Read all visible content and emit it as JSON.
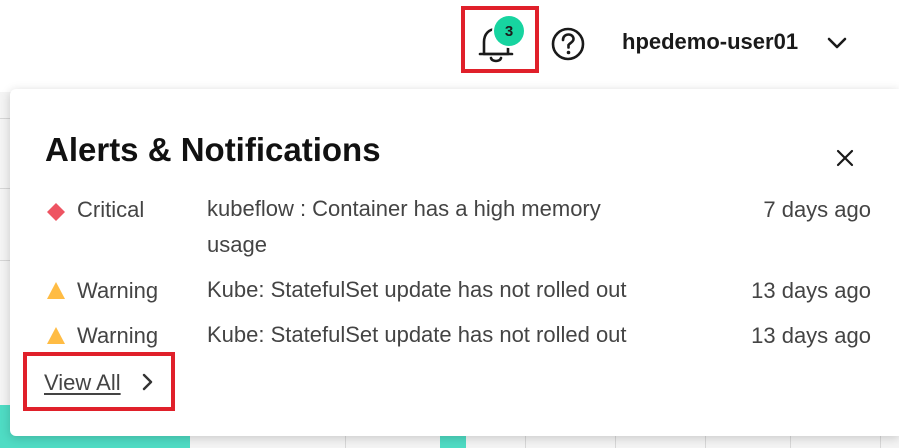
{
  "header": {
    "notification_count": "3",
    "username": "hpedemo-user01"
  },
  "panel": {
    "title": "Alerts & Notifications",
    "alerts": [
      {
        "severity": "Critical",
        "message": "kubeflow : Container has a high memory usage",
        "time": "7 days ago",
        "color": "#ee5462"
      },
      {
        "severity": "Warning",
        "message": "Kube: StatefulSet update has not rolled out",
        "time": "13 days ago",
        "color": "#ffbc44"
      },
      {
        "severity": "Warning",
        "message": "Kube: StatefulSet update has not rolled out",
        "time": "13 days ago",
        "color": "#ffbc44"
      }
    ],
    "view_all_label": "View All"
  },
  "colors": {
    "badge": "#17d4a0",
    "highlight": "#e0202a",
    "critical": "#ee5462",
    "warning": "#ffbc44"
  },
  "icons": [
    "bell-icon",
    "help-icon",
    "chevron-down-icon",
    "close-icon",
    "critical-diamond-icon",
    "warning-triangle-icon",
    "chevron-right-icon"
  ]
}
